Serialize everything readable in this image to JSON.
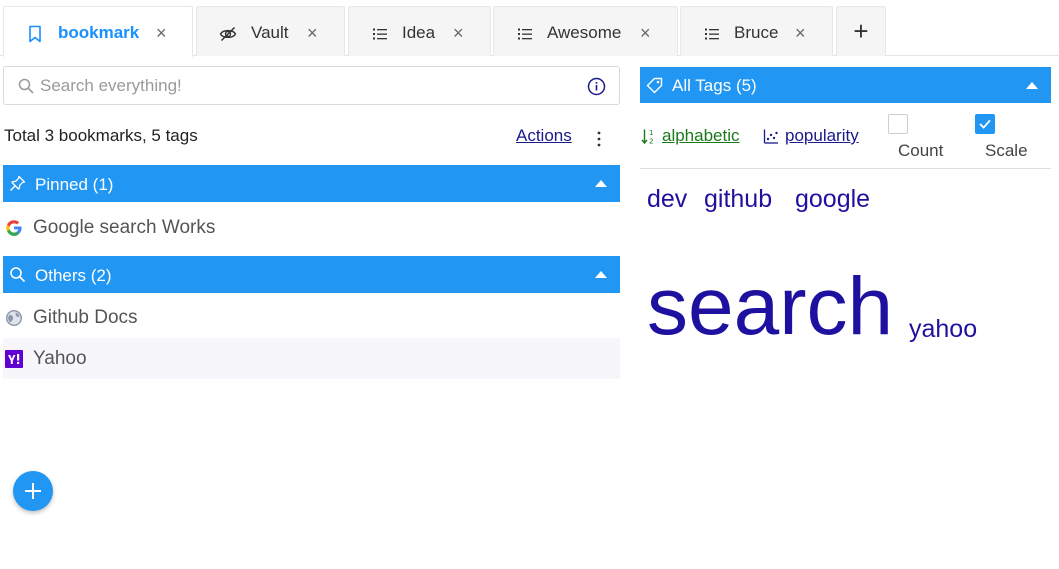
{
  "tabs": [
    {
      "label": "bookmark",
      "icon": "bookmark-icon",
      "active": true,
      "close": "×"
    },
    {
      "label": "Vault",
      "icon": "eye-off-icon",
      "active": false,
      "close": "×"
    },
    {
      "label": "Idea",
      "icon": "list-icon",
      "active": false,
      "close": "×"
    },
    {
      "label": "Awesome",
      "icon": "list-icon",
      "active": false,
      "close": "×"
    },
    {
      "label": "Bruce",
      "icon": "list-icon",
      "active": false,
      "close": "×"
    }
  ],
  "add_tab": "+",
  "search": {
    "placeholder": "Search everything!",
    "value": ""
  },
  "summary": {
    "totals": "Total 3 bookmarks, 5 tags",
    "actions": "Actions"
  },
  "groups": [
    {
      "label": "Pinned (1)",
      "icon": "pin-icon",
      "items": [
        {
          "label": "Google search Works",
          "icon": "google-favicon"
        }
      ]
    },
    {
      "label": "Others (2)",
      "icon": "search-icon",
      "items": [
        {
          "label": "Github Docs",
          "icon": "globe-favicon"
        },
        {
          "label": "Yahoo",
          "icon": "yahoo-favicon"
        }
      ]
    }
  ],
  "tags_panel": {
    "title": "All Tags (5)",
    "sort_alphabetic": "alphabetic",
    "sort_popularity": "popularity",
    "count_label": "Count",
    "count_checked": false,
    "scale_label": "Scale",
    "scale_checked": true
  },
  "tags": [
    {
      "name": "dev"
    },
    {
      "name": "github"
    },
    {
      "name": "google"
    },
    {
      "name": "search"
    },
    {
      "name": "yahoo"
    }
  ],
  "colors": {
    "accent": "#2196f3",
    "tag_text": "#1f119f",
    "alphabetic_link": "#1a7a1a",
    "link": "#1a1a8c"
  }
}
